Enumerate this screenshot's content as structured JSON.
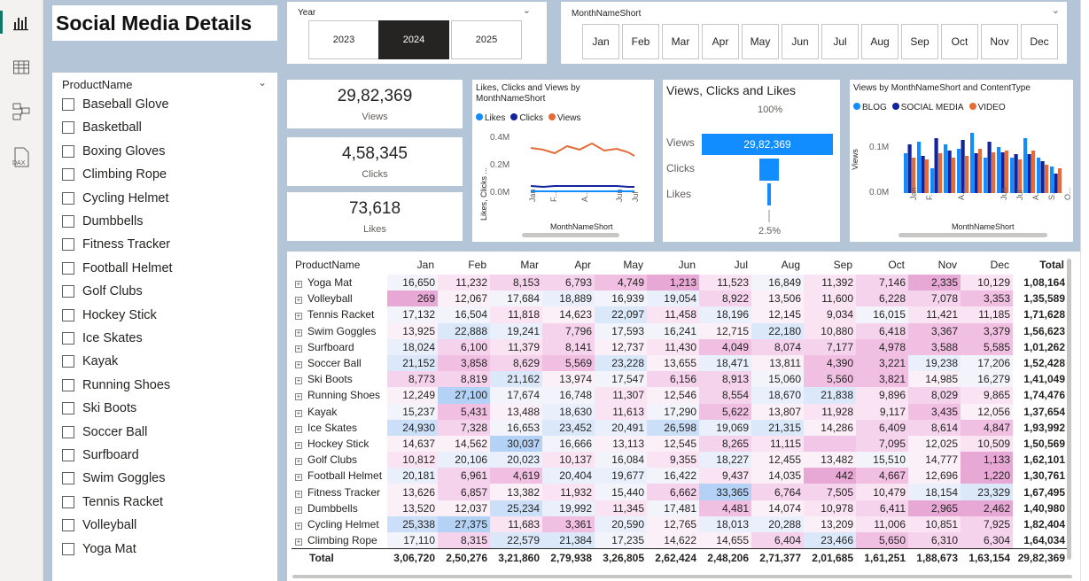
{
  "title": "Social Media Details",
  "year_slicer": {
    "label": "Year",
    "options": [
      "2023",
      "2024",
      "2025"
    ],
    "selected": "2024"
  },
  "month_slicer": {
    "label": "MonthNameShort",
    "options": [
      "Jan",
      "Feb",
      "Mar",
      "Apr",
      "May",
      "Jun",
      "Jul",
      "Aug",
      "Sep",
      "Oct",
      "Nov",
      "Dec"
    ]
  },
  "product_slicer": {
    "label": "ProductName",
    "items": [
      "Baseball Glove",
      "Basketball",
      "Boxing Gloves",
      "Climbing Rope",
      "Cycling Helmet",
      "Dumbbells",
      "Fitness Tracker",
      "Football Helmet",
      "Golf Clubs",
      "Hockey Stick",
      "Ice Skates",
      "Kayak",
      "Running Shoes",
      "Ski Boots",
      "Soccer Ball",
      "Surfboard",
      "Swim Goggles",
      "Tennis Racket",
      "Volleyball",
      "Yoga Mat"
    ]
  },
  "cards": [
    {
      "value": "29,82,369",
      "caption": "Views"
    },
    {
      "value": "4,58,345",
      "caption": "Clicks"
    },
    {
      "value": "73,618",
      "caption": "Likes"
    }
  ],
  "line_chart": {
    "title": "Likes, Clicks and Views by MonthNameShort",
    "legend": [
      "Likes",
      "Clicks",
      "Views"
    ],
    "ylabel": "Likes, Clicks ...",
    "xlabel": "MonthNameShort",
    "yticks": [
      "0.4M",
      "0.2M",
      "0.0M"
    ],
    "xticks": [
      "Jan",
      "F...",
      "A...",
      "Jun",
      "Jul"
    ],
    "colors": {
      "Likes": "#118dff",
      "Clicks": "#12239e",
      "Views": "#e66c37"
    }
  },
  "funnel": {
    "title": "Views, Clicks and Likes",
    "top_pct": "100%",
    "bottom_pct": "2.5%",
    "stages": [
      "Views",
      "Clicks",
      "Likes"
    ],
    "views_label": "29,82,369"
  },
  "bar_chart": {
    "title": "Views by MonthNameShort and ContentType",
    "legend": [
      "BLOG",
      "SOCIAL MEDIA",
      "VIDEO"
    ],
    "ylabel": "Views",
    "xlabel": "MonthNameShort",
    "yticks": [
      "0.1M",
      "0.0M"
    ],
    "xticks": [
      "Jan",
      "F...",
      "A...",
      "Jun",
      "Jul",
      "A...",
      "S...",
      "O..."
    ],
    "colors": {
      "BLOG": "#118dff",
      "SOCIAL MEDIA": "#12239e",
      "VIDEO": "#e66c37"
    }
  },
  "matrix": {
    "row_header": "ProductName",
    "columns": [
      "Jan",
      "Feb",
      "Mar",
      "Apr",
      "May",
      "Jun",
      "Jul",
      "Aug",
      "Sep",
      "Oct",
      "Nov",
      "Dec",
      "Total"
    ],
    "rows": [
      [
        "Yoga Mat",
        "16,650",
        "11,232",
        "8,153",
        "6,793",
        "4,749",
        "1,213",
        "11,523",
        "16,849",
        "11,392",
        "7,146",
        "2,335",
        "10,129",
        "1,08,164"
      ],
      [
        "Volleyball",
        "269",
        "12,067",
        "17,684",
        "18,889",
        "16,939",
        "19,054",
        "8,922",
        "13,506",
        "11,600",
        "6,228",
        "7,078",
        "3,353",
        "1,35,589"
      ],
      [
        "Tennis Racket",
        "17,132",
        "16,504",
        "11,818",
        "14,623",
        "22,097",
        "11,458",
        "18,196",
        "12,145",
        "9,034",
        "16,015",
        "11,421",
        "11,185",
        "1,71,628"
      ],
      [
        "Swim Goggles",
        "13,925",
        "22,888",
        "19,241",
        "7,796",
        "17,593",
        "16,241",
        "12,715",
        "22,180",
        "10,880",
        "6,418",
        "3,367",
        "3,379",
        "1,56,623"
      ],
      [
        "Surfboard",
        "18,024",
        "6,100",
        "11,379",
        "8,141",
        "12,737",
        "11,430",
        "4,049",
        "8,074",
        "7,177",
        "4,978",
        "3,588",
        "5,585",
        "1,01,262"
      ],
      [
        "Soccer Ball",
        "21,152",
        "3,858",
        "8,629",
        "5,569",
        "23,228",
        "13,655",
        "18,471",
        "13,811",
        "4,390",
        "3,221",
        "19,238",
        "17,206",
        "1,52,428"
      ],
      [
        "Ski Boots",
        "8,773",
        "8,819",
        "21,162",
        "13,974",
        "17,547",
        "6,156",
        "8,913",
        "15,060",
        "5,560",
        "3,821",
        "14,985",
        "16,279",
        "1,41,049"
      ],
      [
        "Running Shoes",
        "12,249",
        "27,100",
        "17,674",
        "16,748",
        "11,307",
        "12,546",
        "8,554",
        "18,670",
        "21,838",
        "9,896",
        "8,029",
        "9,865",
        "1,74,476"
      ],
      [
        "Kayak",
        "15,237",
        "5,431",
        "13,488",
        "18,630",
        "11,613",
        "17,290",
        "5,622",
        "13,807",
        "11,928",
        "9,117",
        "3,435",
        "12,056",
        "1,37,654"
      ],
      [
        "Ice Skates",
        "24,930",
        "7,328",
        "16,653",
        "23,452",
        "20,491",
        "26,598",
        "19,069",
        "21,315",
        "14,286",
        "6,409",
        "8,614",
        "4,847",
        "1,93,992"
      ],
      [
        "Hockey Stick",
        "14,637",
        "14,562",
        "30,037",
        "16,666",
        "13,113",
        "12,545",
        "8,265",
        "11,115",
        "",
        "7,095",
        "12,025",
        "10,509",
        "1,50,569"
      ],
      [
        "Golf Clubs",
        "10,812",
        "20,106",
        "20,023",
        "10,137",
        "16,084",
        "9,355",
        "18,227",
        "12,455",
        "13,482",
        "15,510",
        "14,777",
        "1,133",
        "1,62,101"
      ],
      [
        "Football Helmet",
        "20,181",
        "6,961",
        "4,619",
        "20,404",
        "19,677",
        "16,422",
        "9,437",
        "14,035",
        "442",
        "4,667",
        "12,696",
        "1,220",
        "1,30,761"
      ],
      [
        "Fitness Tracker",
        "13,626",
        "6,857",
        "13,382",
        "11,932",
        "15,440",
        "6,662",
        "33,365",
        "6,764",
        "7,505",
        "10,479",
        "18,154",
        "23,329",
        "1,67,495"
      ],
      [
        "Dumbbells",
        "13,520",
        "12,037",
        "25,234",
        "19,992",
        "11,345",
        "17,481",
        "4,481",
        "14,074",
        "10,978",
        "6,411",
        "2,965",
        "2,462",
        "1,40,980"
      ],
      [
        "Cycling Helmet",
        "25,338",
        "27,375",
        "11,683",
        "3,361",
        "20,590",
        "12,765",
        "18,013",
        "20,288",
        "13,209",
        "11,006",
        "10,851",
        "7,925",
        "1,82,404"
      ],
      [
        "Climbing Rope",
        "17,110",
        "8,315",
        "22,579",
        "21,384",
        "17,235",
        "14,622",
        "14,655",
        "6,404",
        "23,466",
        "5,650",
        "6,310",
        "6,304",
        "1,64,034"
      ]
    ],
    "total_row": [
      "Total",
      "3,06,720",
      "2,50,276",
      "3,21,860",
      "2,79,938",
      "3,26,805",
      "2,62,424",
      "2,48,206",
      "2,71,377",
      "2,01,685",
      "1,61,251",
      "1,88,673",
      "1,63,154",
      "29,82,369"
    ]
  }
}
